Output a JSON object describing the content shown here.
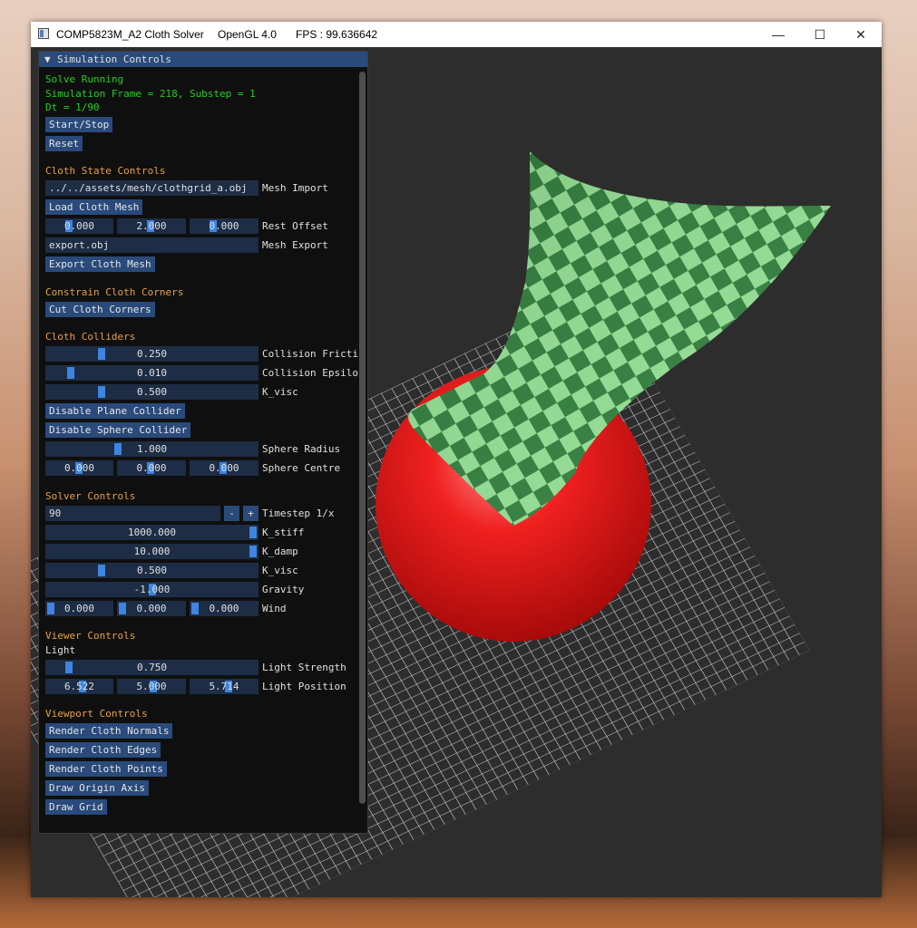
{
  "window": {
    "title": "COMP5823M_A2 Cloth Solver",
    "gl": "OpenGL 4.0",
    "fps": "FPS : 99.636642",
    "min_icon": "minimize-icon",
    "max_icon": "maximize-icon",
    "close_icon": "close-icon"
  },
  "panel": {
    "title": "Simulation Controls",
    "status": {
      "running": "Solve Running",
      "frame": "Simulation Frame = 218, Substep = 1",
      "dt": "Dt = 1/90"
    },
    "buttons": {
      "start_stop": "Start/Stop",
      "reset": "Reset"
    },
    "cloth_state": {
      "header": "Cloth State Controls",
      "mesh_path": "../../assets/mesh/clothgrid_a.obj",
      "mesh_import_label": "Mesh Import",
      "load_button": "Load Cloth Mesh",
      "rest_offset": [
        "0.000",
        "2.000",
        "0.000"
      ],
      "rest_offset_label": "Rest Offset",
      "export_file": "export.obj",
      "export_label": "Mesh Export",
      "export_button": "Export Cloth Mesh"
    },
    "constrain": {
      "header": "Constrain Cloth Corners",
      "button": "Cut Cloth Corners"
    },
    "colliders": {
      "header": "Cloth Colliders",
      "friction": {
        "value": "0.250",
        "label": "Collision Fricti",
        "level": 0.25
      },
      "epsilon": {
        "value": "0.010",
        "label": "Collision Epsilo",
        "level": 0.1
      },
      "kvisc": {
        "value": "0.500",
        "label": "K_visc",
        "level": 0.25
      },
      "disable_plane": "Disable Plane Collider",
      "disable_sphere": "Disable Sphere Collider",
      "radius": {
        "value": "1.000",
        "label": "Sphere Radius",
        "level": 0.33
      },
      "centre": [
        "0.000",
        "0.000",
        "0.000"
      ],
      "centre_label": "Sphere Centre"
    },
    "solver": {
      "header": "Solver Controls",
      "timestep": "90",
      "timestep_minus": "-",
      "timestep_plus": "+",
      "timestep_label": "Timestep 1/x",
      "kstiff": {
        "value": "1000.000",
        "label": "K_stiff",
        "level": 1.0
      },
      "kdamp": {
        "value": "10.000",
        "label": "K_damp",
        "level": 1.0
      },
      "kvisc": {
        "value": "0.500",
        "label": "K_visc",
        "level": 0.25
      },
      "gravity": {
        "value": "-1.000",
        "label": "Gravity",
        "level": 0.5
      },
      "wind": [
        "0.000",
        "0.000",
        "0.000"
      ],
      "wind_label": "Wind"
    },
    "viewer": {
      "header": "Viewer Controls",
      "light_header": "Light",
      "strength": {
        "value": "0.750",
        "label": "Light Strength",
        "level": 0.09
      },
      "position": [
        "6.522",
        "5.000",
        "5.714"
      ],
      "position_label": "Light Position"
    },
    "viewport": {
      "header": "Viewport Controls",
      "normals": "Render Cloth Normals",
      "edges": "Render Cloth Edges",
      "points": "Render Cloth Points",
      "axis": "Draw Origin Axis",
      "grid": "Draw Grid"
    }
  },
  "colors": {
    "panel_bg": "#0f0f0f",
    "accent": "#3d85e0",
    "button": "#294a7a",
    "status_green": "#20d020",
    "header_orange": "#e8a040",
    "sphere": "#e8141a",
    "cloth": "#2f7a3a"
  }
}
